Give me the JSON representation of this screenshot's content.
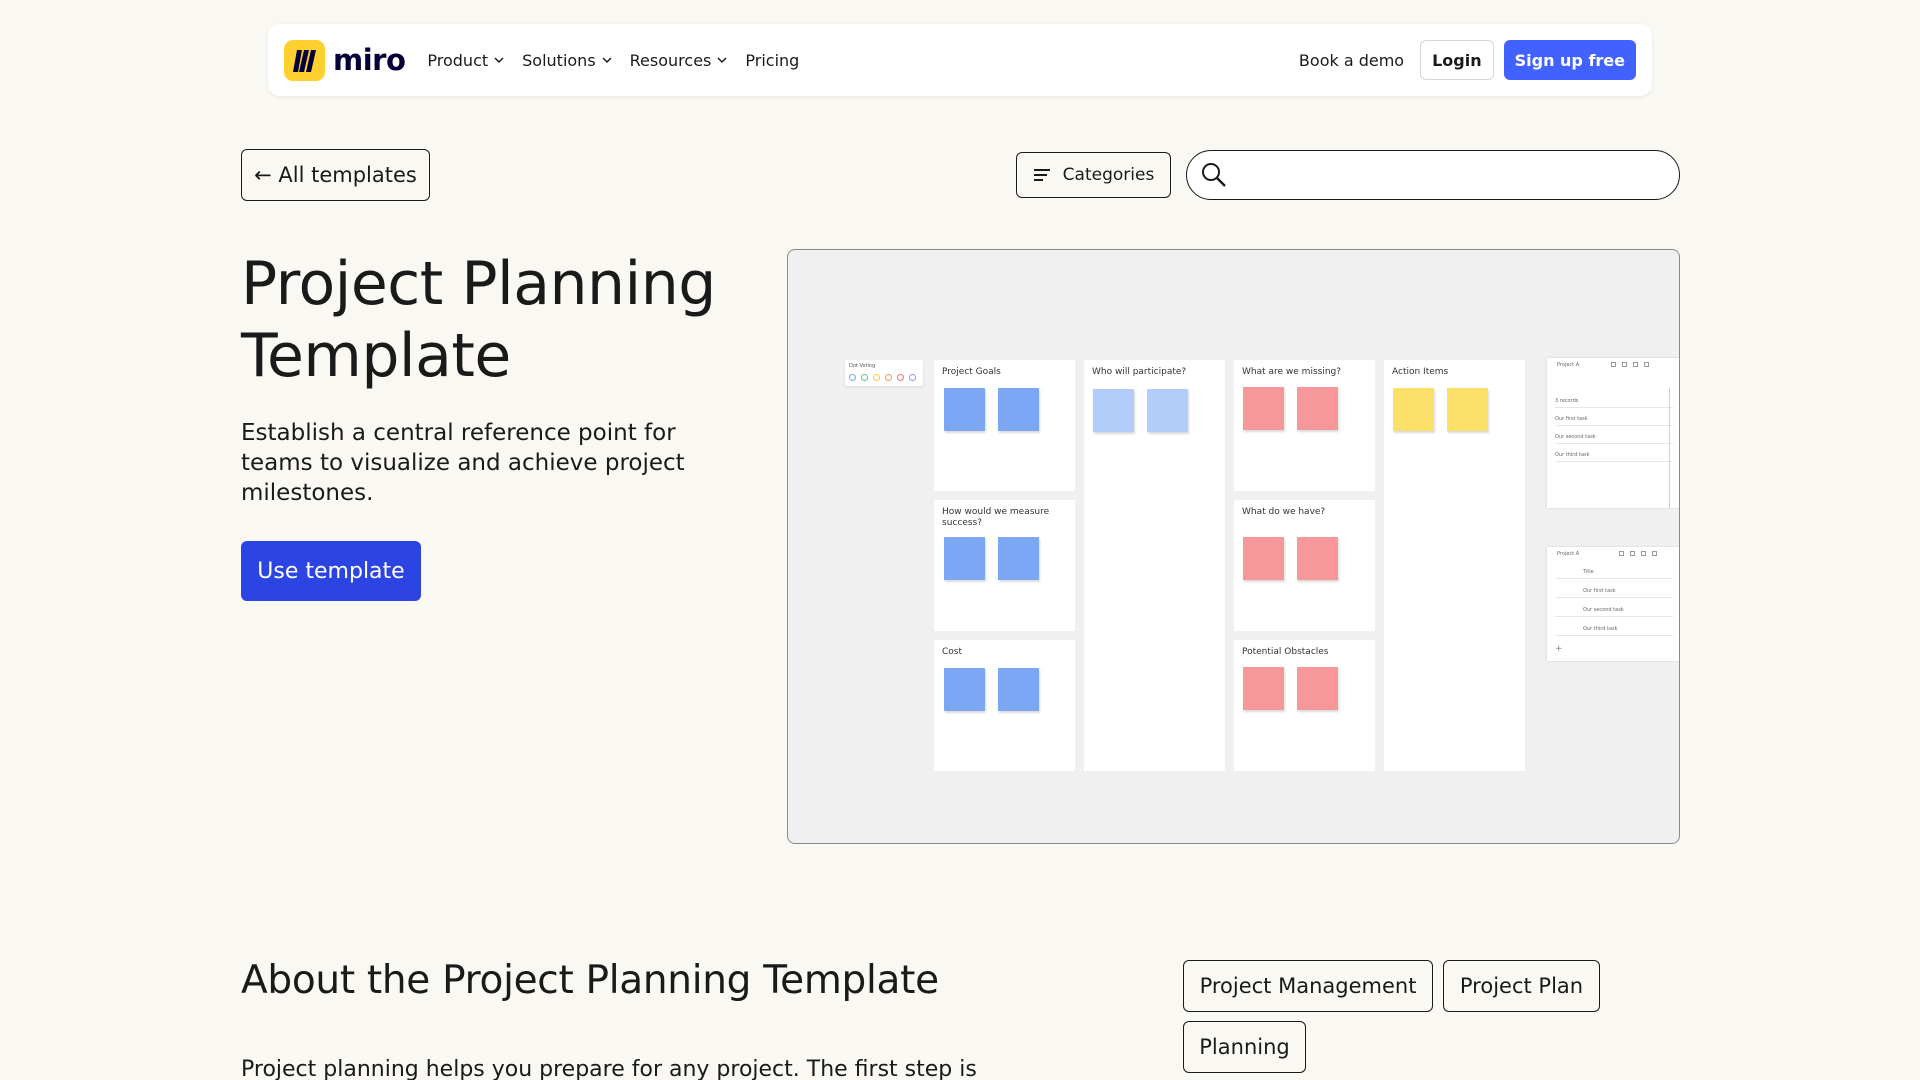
{
  "nav": {
    "logo_text": "miro",
    "items": [
      {
        "label": "Product",
        "has_menu": true
      },
      {
        "label": "Solutions",
        "has_menu": true
      },
      {
        "label": "Resources",
        "has_menu": true
      },
      {
        "label": "Pricing",
        "has_menu": false
      }
    ],
    "book_demo": "Book a demo",
    "login": "Login",
    "signup": "Sign up free"
  },
  "toolbar": {
    "back_label": "← All templates",
    "categories_label": "Categories",
    "search_placeholder": "",
    "search_value": ""
  },
  "hero": {
    "title_line1": "Project Planning",
    "title_line2": "Template",
    "description": "Establish a central reference point for teams to visualize and achieve project milestones.",
    "cta": "Use template"
  },
  "preview": {
    "legend_title": "Dot Voting",
    "columns": [
      {
        "title": "Project Goals"
      },
      {
        "title": "How would we measure success?"
      },
      {
        "title": "Cost"
      },
      {
        "title": "Who will participate?"
      },
      {
        "title": "What are we missing?"
      },
      {
        "title": "What do we have?"
      },
      {
        "title": "Potential Obstacles"
      },
      {
        "title": "Action Items"
      }
    ],
    "db_top": {
      "title": "Project A",
      "rows": [
        "3 records",
        "Our first task",
        "Our second task",
        "Our third task"
      ]
    },
    "db_bottom": {
      "title": "Project A",
      "rows": [
        "Title",
        "Our first task",
        "Our second task",
        "Our third task"
      ]
    }
  },
  "about": {
    "title": "About the Project Planning Template",
    "text": "Project planning helps you prepare for any project. The first step is"
  },
  "tags": [
    "Project Management",
    "Project Plan",
    "Planning"
  ],
  "colors": {
    "brand_yellow": "#ffd02f",
    "primary_blue": "#4262ff",
    "cta_blue": "#2b44e2",
    "page_bg": "#faf8f2"
  }
}
